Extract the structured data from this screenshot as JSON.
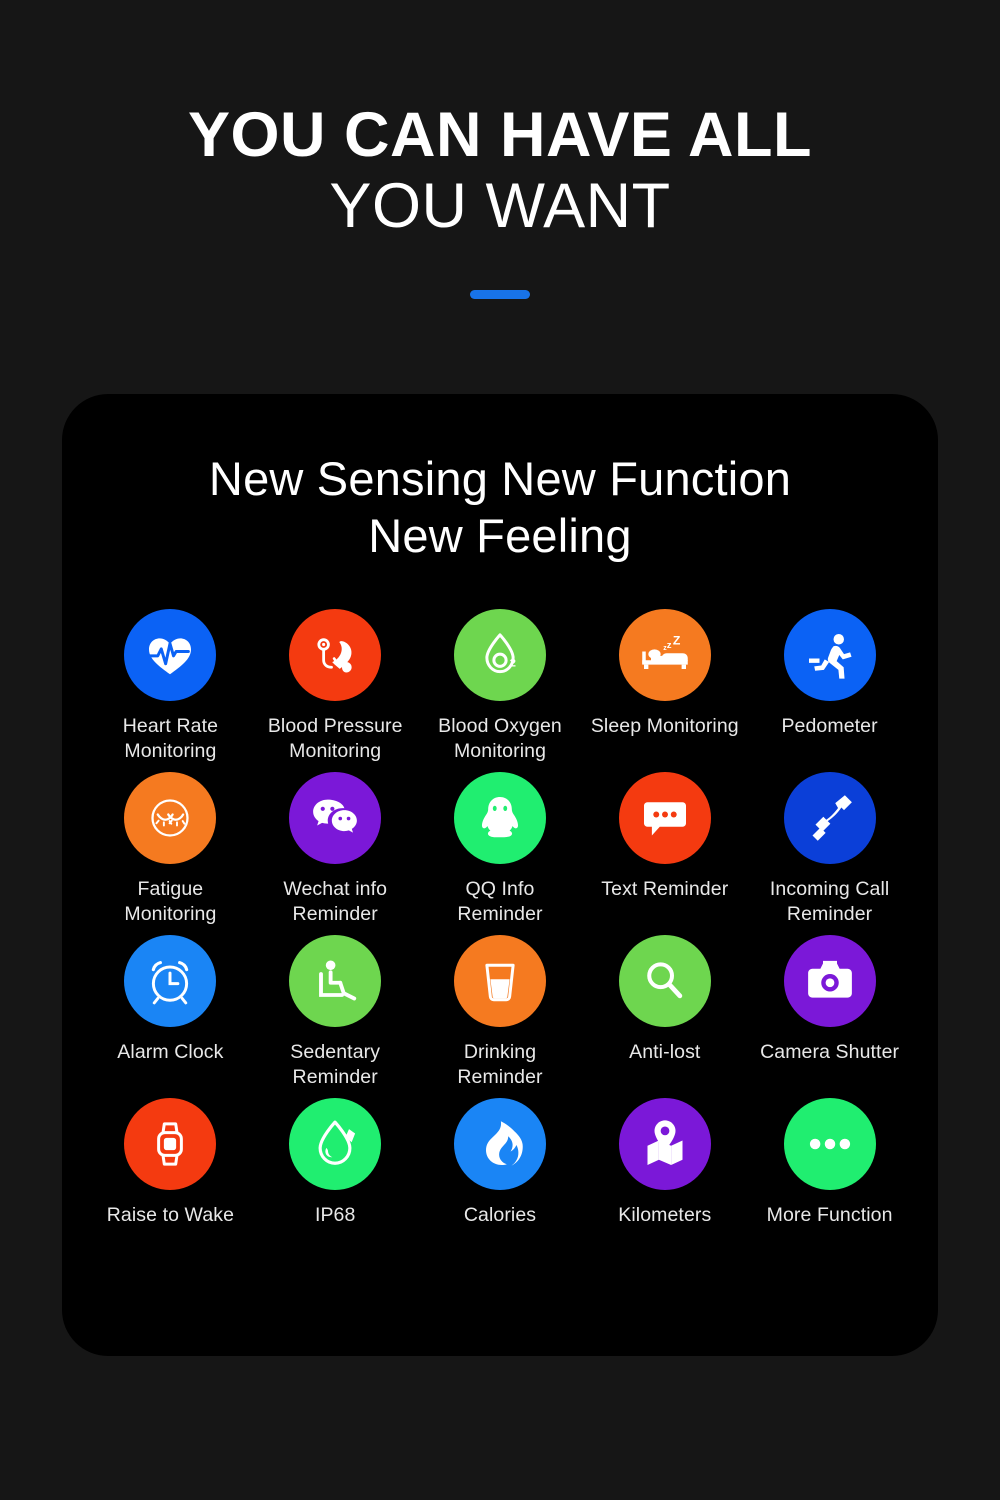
{
  "header": {
    "line1": "YOU CAN HAVE ALL",
    "line2": "YOU WANT",
    "accent_color": "#1873e8"
  },
  "card": {
    "title_line1": "New Sensing New Function",
    "title_line2": "New Feeling",
    "background": "#000000"
  },
  "palette": {
    "blue": "#0b62f5",
    "red_orange": "#f43a10",
    "green": "#6ed64f",
    "orange": "#f57a20",
    "purple": "#7b18d8",
    "bright_green": "#20ee70"
  },
  "features": [
    {
      "label": "Heart Rate\nMonitoring",
      "icon": "heart-pulse-icon",
      "color": "#0b62f5"
    },
    {
      "label": "Blood Pressure\nMonitoring",
      "icon": "blood-pressure-icon",
      "color": "#f43a10"
    },
    {
      "label": "Blood Oxygen\nMonitoring",
      "icon": "blood-oxygen-icon",
      "color": "#6ed64f"
    },
    {
      "label": "Sleep Monitoring",
      "icon": "sleep-bed-icon",
      "color": "#f57a20"
    },
    {
      "label": "Pedometer",
      "icon": "running-person-icon",
      "color": "#0b62f5"
    },
    {
      "label": "Fatigue\nMonitoring",
      "icon": "closed-eye-face-icon",
      "color": "#f57a20"
    },
    {
      "label": "Wechat info\nReminder",
      "icon": "wechat-icon",
      "color": "#7b18d8"
    },
    {
      "label": "QQ Info\nReminder",
      "icon": "qq-penguin-icon",
      "color": "#20ee70"
    },
    {
      "label": "Text Reminder",
      "icon": "message-bubble-icon",
      "color": "#f43a10"
    },
    {
      "label": "Incoming Call\nReminder",
      "icon": "phone-handset-icon",
      "color": "#0b3fd8"
    },
    {
      "label": "Alarm Clock",
      "icon": "alarm-clock-icon",
      "color": "#1a85f5"
    },
    {
      "label": "Sedentary\nReminder",
      "icon": "sitting-person-icon",
      "color": "#6ed64f"
    },
    {
      "label": "Drinking Reminder",
      "icon": "water-glass-icon",
      "color": "#f57a20"
    },
    {
      "label": "Anti-lost",
      "icon": "magnifier-icon",
      "color": "#6ed64f"
    },
    {
      "label": "Camera Shutter",
      "icon": "camera-icon",
      "color": "#7b18d8"
    },
    {
      "label": "Raise to Wake",
      "icon": "smartwatch-icon",
      "color": "#f43a10"
    },
    {
      "label": "IP68",
      "icon": "water-drop-icon",
      "color": "#20ee70"
    },
    {
      "label": "Calories",
      "icon": "flame-icon",
      "color": "#1a85f5"
    },
    {
      "label": "Kilometers",
      "icon": "map-pin-icon",
      "color": "#7b18d8"
    },
    {
      "label": "More Function",
      "icon": "ellipsis-icon",
      "color": "#20ee70"
    }
  ]
}
